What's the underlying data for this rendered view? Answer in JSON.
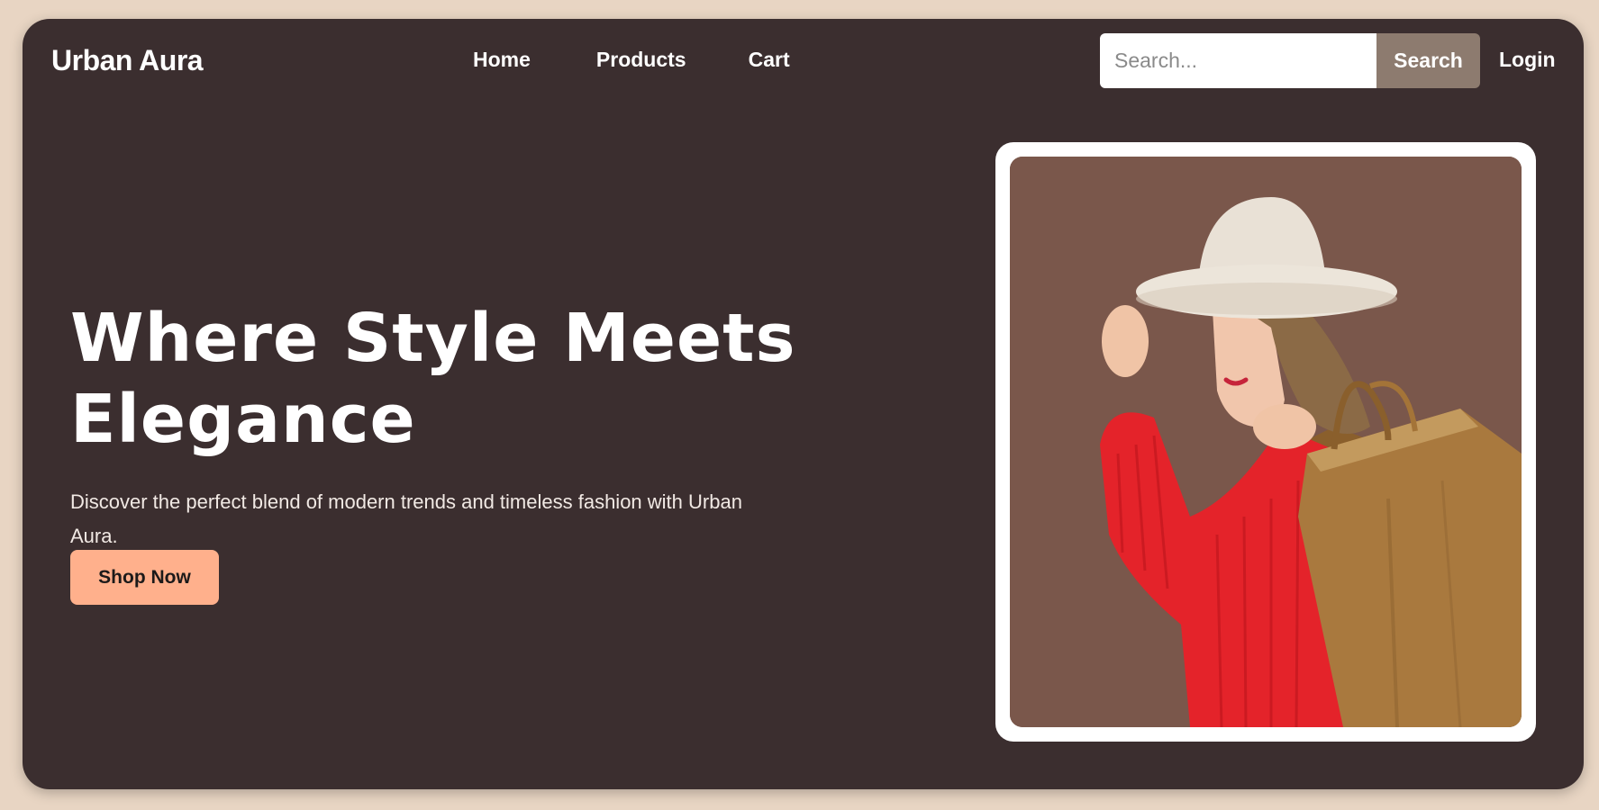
{
  "header": {
    "brand": "Urban Aura",
    "nav": [
      {
        "label": "Home"
      },
      {
        "label": "Products"
      },
      {
        "label": "Cart"
      }
    ],
    "search": {
      "placeholder": "Search...",
      "value": "",
      "button_label": "Search"
    },
    "login_label": "Login"
  },
  "hero": {
    "title": "Where Style Meets Elegance",
    "subtitle": "Discover the perfect blend of modern trends and timeless fashion with Urban Aura.",
    "cta_label": "Shop Now",
    "image_subject": "woman-in-hat-with-shopping-bags"
  },
  "colors": {
    "page_bg": "#e8d5c3",
    "frame_bg": "#3b2e2f",
    "search_button": "#8d7b6f",
    "cta_button": "#ffb08c",
    "photo_bg": "#7a574b",
    "sweater_red": "#e4232a",
    "bag_gold": "#a9793e"
  }
}
